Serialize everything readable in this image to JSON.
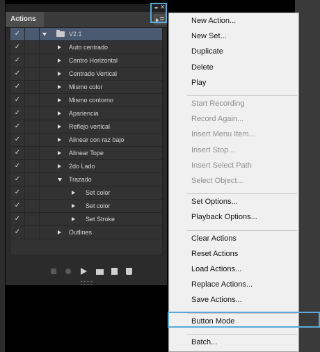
{
  "panel": {
    "tab_label": "Actions",
    "rows": [
      {
        "label": "V2.1",
        "type": "set",
        "expanded": true,
        "selected": true
      },
      {
        "label": "Auto centrado",
        "type": "action"
      },
      {
        "label": "Centro Horizontal",
        "type": "action"
      },
      {
        "label": "Centrado Vertical",
        "type": "action"
      },
      {
        "label": "Mismo color",
        "type": "action"
      },
      {
        "label": "Mismo contorno",
        "type": "action"
      },
      {
        "label": "Apariencia",
        "type": "action"
      },
      {
        "label": "Reflejo vertical",
        "type": "action"
      },
      {
        "label": "Alinear con raz bajo",
        "type": "action"
      },
      {
        "label": "Alinear Tope",
        "type": "action"
      },
      {
        "label": "2do Lado",
        "type": "action"
      },
      {
        "label": "Trazado",
        "type": "action",
        "expanded": true
      },
      {
        "label": "Set color",
        "type": "step"
      },
      {
        "label": "Set color",
        "type": "step"
      },
      {
        "label": "Set Stroke",
        "type": "step"
      },
      {
        "label": "Outlines",
        "type": "action"
      }
    ],
    "checkmark": "✓",
    "icons": [
      "stop-icon",
      "record-icon",
      "play-icon",
      "new-set-folder-icon",
      "new-action-icon",
      "trash-icon"
    ]
  },
  "menu": {
    "groups": [
      [
        {
          "label": "New Action...",
          "enabled": true
        },
        {
          "label": "New Set...",
          "enabled": true
        },
        {
          "label": "Duplicate",
          "enabled": true
        },
        {
          "label": "Delete",
          "enabled": true
        },
        {
          "label": "Play",
          "enabled": true
        }
      ],
      [
        {
          "label": "Start Recording",
          "enabled": false
        },
        {
          "label": "Record Again...",
          "enabled": false
        },
        {
          "label": "Insert Menu Item...",
          "enabled": false
        },
        {
          "label": "Insert Stop...",
          "enabled": false
        },
        {
          "label": "Insert Select Path",
          "enabled": false
        },
        {
          "label": "Select Object...",
          "enabled": false
        }
      ],
      [
        {
          "label": "Set Options...",
          "enabled": true
        },
        {
          "label": "Playback Options...",
          "enabled": true
        }
      ],
      [
        {
          "label": "Clear Actions",
          "enabled": true
        },
        {
          "label": "Reset Actions",
          "enabled": true
        },
        {
          "label": "Load Actions...",
          "enabled": true
        },
        {
          "label": "Replace Actions...",
          "enabled": true
        },
        {
          "label": "Save Actions...",
          "enabled": true
        }
      ],
      [
        {
          "label": "Button Mode",
          "enabled": true,
          "highlighted": true
        }
      ],
      [
        {
          "label": "Batch...",
          "enabled": true
        }
      ]
    ]
  },
  "colors": {
    "highlight_border": "#5aa9d6",
    "selected_row": "#4a5a70",
    "menu_bg": "#f0f0f0"
  }
}
